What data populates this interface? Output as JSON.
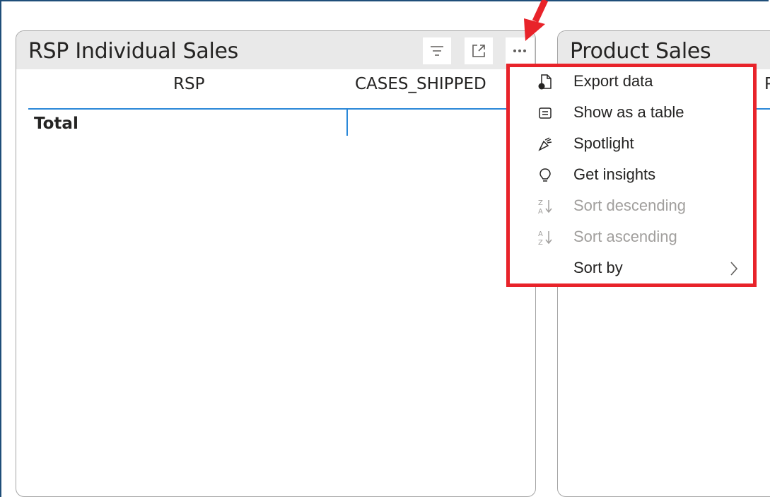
{
  "visuals": {
    "left": {
      "title": "RSP Individual Sales",
      "columns": [
        "RSP",
        "CASES_SHIPPED"
      ],
      "total_label": "Total",
      "header_buttons": [
        "filter-icon",
        "focus-mode-icon",
        "more-options-icon"
      ]
    },
    "right": {
      "title": "Product Sales",
      "partial_column": "P"
    }
  },
  "context_menu": {
    "items": [
      {
        "label": "Export data",
        "icon": "export-data-icon",
        "enabled": true
      },
      {
        "label": "Show as a table",
        "icon": "show-table-icon",
        "enabled": true
      },
      {
        "label": "Spotlight",
        "icon": "spotlight-icon",
        "enabled": true
      },
      {
        "label": "Get insights",
        "icon": "lightbulb-icon",
        "enabled": true
      },
      {
        "label": "Sort descending",
        "icon": "sort-descending-icon",
        "enabled": false
      },
      {
        "label": "Sort ascending",
        "icon": "sort-ascending-icon",
        "enabled": false
      },
      {
        "label": "Sort by",
        "icon": "chevron-right-icon",
        "enabled": true
      }
    ]
  },
  "colors": {
    "highlight_border": "#e8232a",
    "column_rule": "#2b88d8",
    "header_bg": "#e9e9e9",
    "frame": "#1f4e79"
  }
}
